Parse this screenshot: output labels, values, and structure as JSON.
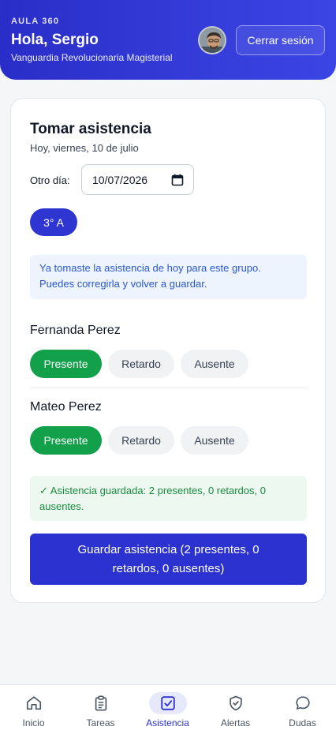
{
  "header": {
    "app_name": "AULA 360",
    "greeting": "Hola, Sergio",
    "organization": "Vanguardia Revolucionaria Magisterial",
    "logout_label": "Cerrar sesión"
  },
  "attendance": {
    "title": "Tomar asistencia",
    "subtitle": "Hoy, viernes, 10 de julio",
    "other_day_label": "Otro día:",
    "date_value": "10/07/2026",
    "group": "3° A",
    "info_message": "Ya tomaste la asistencia de hoy para este grupo. Puedes corregirla y volver a guardar.",
    "options": {
      "present": "Presente",
      "late": "Retardo",
      "absent": "Ausente"
    },
    "students": [
      {
        "name": "Fernanda Perez",
        "status": "Presente"
      },
      {
        "name": "Mateo Perez",
        "status": "Presente"
      }
    ],
    "success_message": "✓ Asistencia guardada: 2 presentes, 0 retardos, 0 ausentes.",
    "save_label": "Guardar asistencia (2 presentes, 0 retardos, 0 ausentes)"
  },
  "nav": {
    "items": [
      {
        "label": "Inicio",
        "icon": "home-icon"
      },
      {
        "label": "Tareas",
        "icon": "clipboard-icon"
      },
      {
        "label": "Asistencia",
        "icon": "checkbox-icon",
        "active": true
      },
      {
        "label": "Alertas",
        "icon": "shield-check-icon"
      },
      {
        "label": "Dudas",
        "icon": "chat-bubble-icon"
      }
    ]
  },
  "colors": {
    "primary": "#2b32cf",
    "present": "#12a04a",
    "info_text": "#2a57d0",
    "success_text": "#178a3d"
  }
}
